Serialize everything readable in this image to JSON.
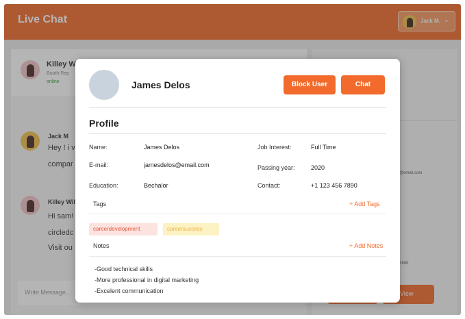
{
  "header": {
    "title": "Live Chat",
    "user_name": "Jack M.",
    "chevron": "chevron-down-icon"
  },
  "background": {
    "contact_name": "Killey Wi",
    "contact_role": "Booth Rep",
    "contact_status": "online",
    "msg1_author": "Jack M",
    "msg1_line1": "Hey ! i v",
    "msg1_line2": "compar",
    "msg2_author": "Killey Wil",
    "msg2_line1": "Hi sam!",
    "msg2_line2": "circledc",
    "msg2_line3": "Visit ou",
    "message_placeholder": "Write Message...",
    "view_label": "View",
    "right_email": "...@email.com",
    "right_phone": "6 7890"
  },
  "modal": {
    "name": "James Delos",
    "block_label": "Block User",
    "chat_label": "Chat",
    "section_title": "Profile",
    "fields": {
      "name_label": "Name:",
      "name_value": "James Delos",
      "email_label": "E-mail:",
      "email_value": "jamesdelos@email.com",
      "education_label": "Education:",
      "education_value": "Bechalor",
      "job_label": "Job Interest:",
      "job_value": "Full Time",
      "passing_label": "Passing year:",
      "passing_value": "2020",
      "contact_label": "Contact:",
      "contact_value": "+1 123 456 7890"
    },
    "tags_label": "Tags",
    "add_tags": "+ Add Tags",
    "tags": [
      "careerdevelopment",
      "careersuccess"
    ],
    "notes_label": "Notes",
    "add_notes": "+ Add Notes",
    "notes": [
      "-Good technical skills",
      "-More professional in digital marketing",
      "-Excelent communication"
    ]
  },
  "colors": {
    "accent": "#f26b2c",
    "tag_red_bg": "#fde3df",
    "tag_yellow_bg": "#fdf2c4"
  }
}
